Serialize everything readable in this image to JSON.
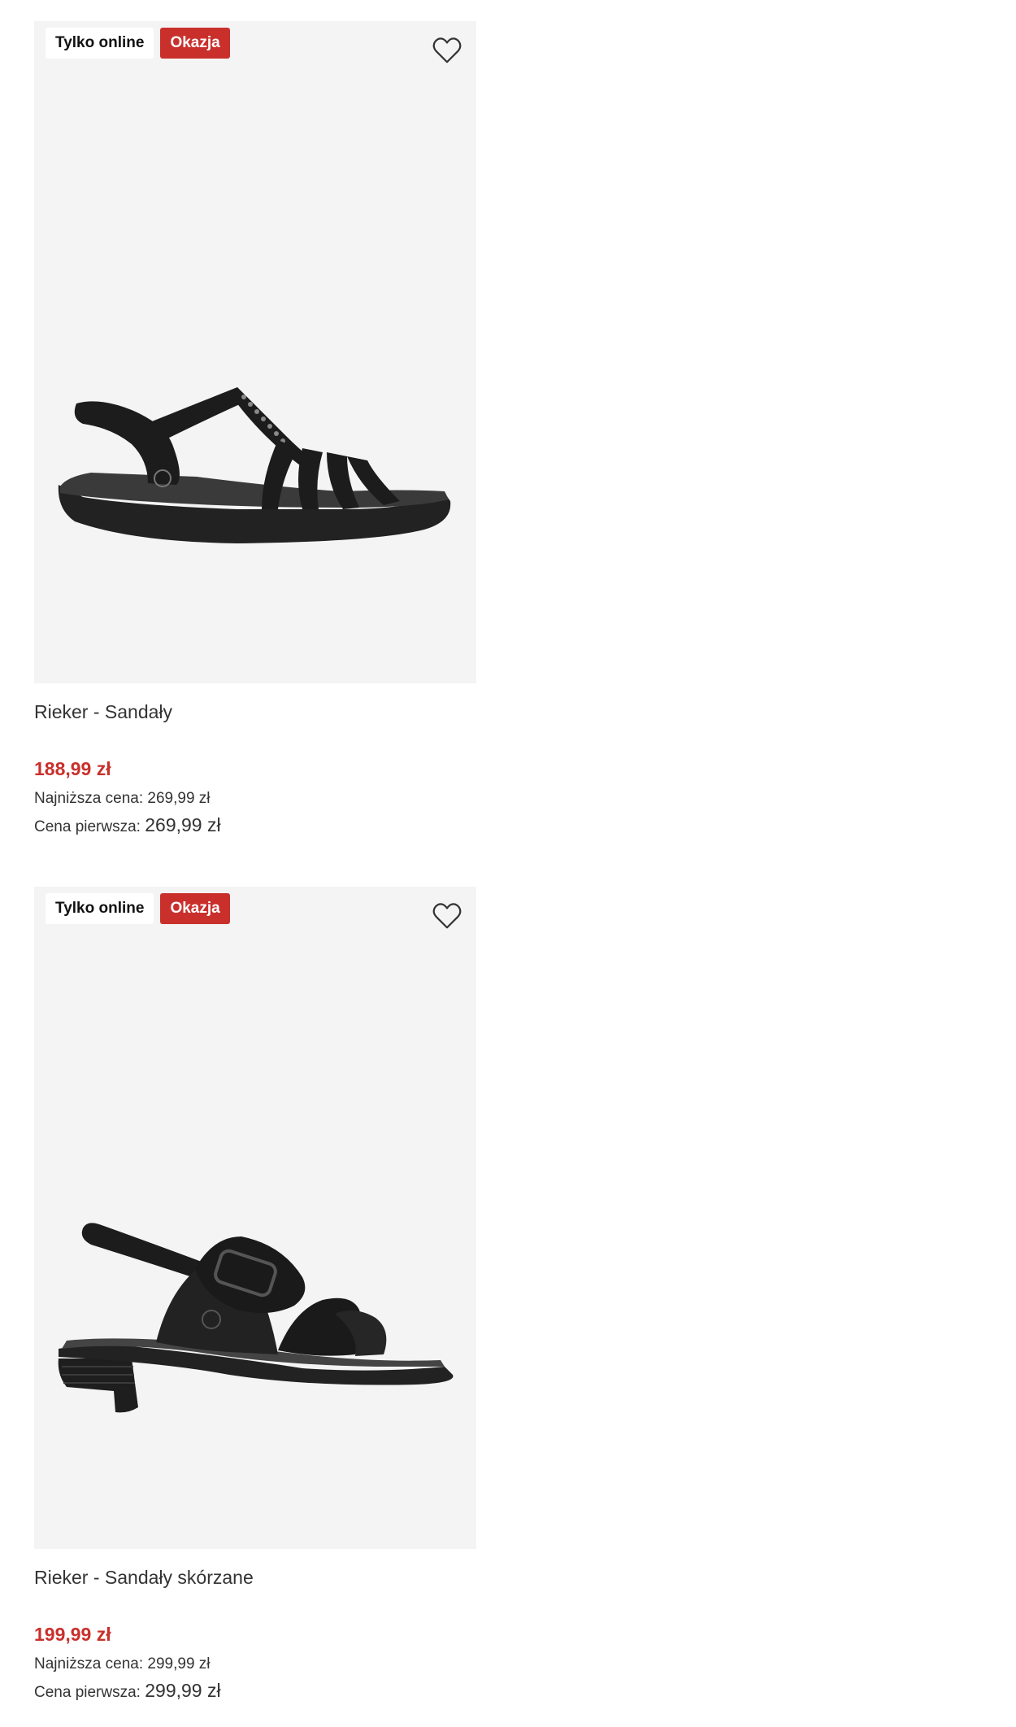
{
  "products": [
    {
      "badges": {
        "online": "Tylko online",
        "deal": "Okazja"
      },
      "favorite_icon": "heart-outline-icon",
      "image_alt": "sandal-strappy-black",
      "title": "Rieker - Sandały",
      "price": "188,99 zł",
      "lowest_label": "Najniższa cena:",
      "lowest_value": "269,99 zł",
      "original_label": "Cena pierwsza:",
      "original_value": "269,99 zł"
    },
    {
      "badges": {
        "online": "Tylko online",
        "deal": "Okazja"
      },
      "favorite_icon": "heart-outline-icon",
      "image_alt": "sandal-buckle-heel-black",
      "title": "Rieker - Sandały skórzane",
      "price": "199,99 zł",
      "lowest_label": "Najniższa cena:",
      "lowest_value": "299,99 zł",
      "original_label": "Cena pierwsza:",
      "original_value": "299,99 zł"
    }
  ],
  "colors": {
    "accent": "#c9302c",
    "image_bg": "#f4f4f4",
    "text": "#333333"
  }
}
